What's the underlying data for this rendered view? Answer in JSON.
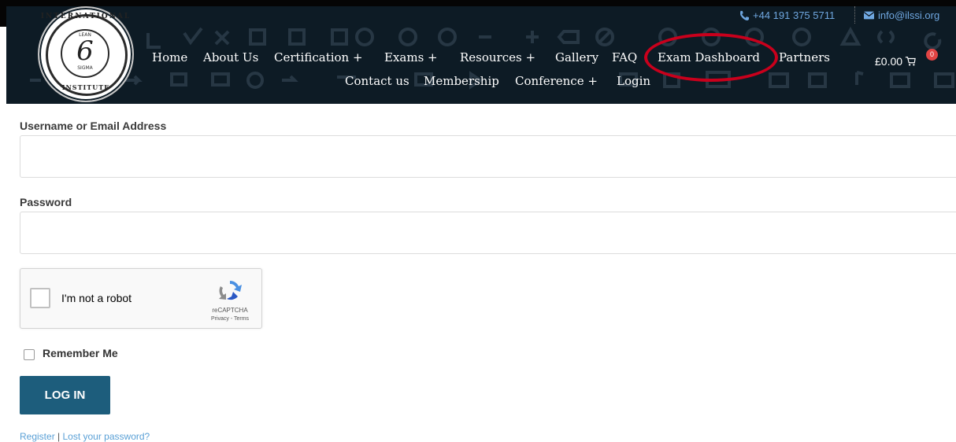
{
  "topbar": {
    "phone": "+44 191 375 5711",
    "email": "info@ilssi.org"
  },
  "logo": {
    "top_text": "INTERNATIONAL",
    "center": "6",
    "lean": "LEAN",
    "sigma": "SIGMA",
    "bottom_text": "INSTITUTE"
  },
  "nav": {
    "row1": [
      "Home",
      "About Us",
      "Certification +",
      "Exams +",
      "Resources +",
      "Gallery",
      "FAQ",
      "Exam Dashboard",
      "Partners"
    ],
    "row2": [
      "Contact us",
      "Membership",
      "Conference +",
      "Login"
    ]
  },
  "cart": {
    "total": "£0.00",
    "count": "0"
  },
  "form": {
    "username_label": "Username or Email Address",
    "password_label": "Password",
    "recaptcha_label": "I'm not a robot",
    "recaptcha_brand": "reCAPTCHA",
    "recaptcha_terms": "Privacy - Terms",
    "remember_label": "Remember Me",
    "login_button": "LOG IN",
    "register_link": "Register",
    "separator": " | ",
    "lost_password_link": "Lost your password?"
  },
  "colors": {
    "header_bg": "#0d1b25",
    "accent_button": "#1d5d7c",
    "highlight_circle": "#c9001c",
    "link": "#5aa0d6"
  }
}
